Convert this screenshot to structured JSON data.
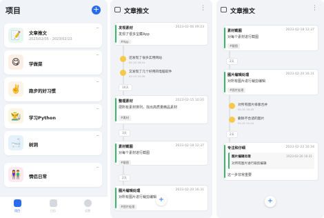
{
  "sidebar": {
    "title": "项目",
    "items": [
      {
        "title": "文章推文",
        "sub": "2023/02/05 - 2023/02/23",
        "emoji": "📝",
        "bg": "#e9f6ef"
      },
      {
        "title": "学做菜",
        "sub": "",
        "emoji": "😋",
        "bg": "#fdeee6"
      },
      {
        "title": "跑步的好习惯",
        "sub": "",
        "emoji": "✌️",
        "bg": "#fdf3e6"
      },
      {
        "title": "学习Python",
        "sub": "",
        "emoji": "👨‍🌾",
        "bg": "#fbf6e3"
      },
      {
        "title": "树洞",
        "sub": "",
        "emoji": "🛁",
        "bg": "#e6f2fb"
      },
      {
        "title": "情侣日常",
        "sub": "",
        "emoji": "👫",
        "bg": "#fdeaf0"
      }
    ],
    "tabs": [
      "项目",
      "日历",
      "设置"
    ],
    "accent": "#2a6cf0"
  },
  "middle": {
    "title": "文章推文",
    "notes": [
      {
        "title": "发现素材",
        "date": "2023-02-06 09:23",
        "body": "发现了很多宝藏App",
        "tag": "#App"
      },
      {
        "title": "整理素材",
        "date": "2023-02-15 10:20",
        "body": "把所有素材排列，找出高质量精品素材",
        "tag": "#素材"
      },
      {
        "title": "素材截图",
        "date": "2023-02-18 12:37",
        "body": "对每个素材进行截图",
        "tag": "#截图"
      },
      {
        "title": "图片编辑处理",
        "date": "2023-02-20 16:31",
        "body": "对所有图片进行裁剪编辑",
        "tag": "#图片处理"
      }
    ],
    "comments": [
      {
        "text": "还发现了很多实用网站",
        "time": "02-10 16:24"
      },
      {
        "text": "又发现了几个好用的电脑软件",
        "time": "02-13 15:28"
      }
    ],
    "gaps": [
      "10天",
      "3天",
      "2天"
    ]
  },
  "right": {
    "title": "文章推文",
    "notes": [
      {
        "title": "素材截图",
        "date": "2023-02-18 12:37",
        "body": "对每个素材进行截图",
        "tag": "#截图"
      },
      {
        "title": "图片编辑处理",
        "date": "2023-02-20 16:31",
        "body": "对所有图片进行裁剪编辑",
        "tag": "#图片处理"
      },
      {
        "title": "专注和仔细",
        "date": "2023-02-22 16:34",
        "body": "这一步非常重要"
      }
    ],
    "gaps": [
      "2天",
      "2天"
    ],
    "comments": [
      {
        "text": "对所有图片排版合并",
        "time": "02-21 10:45"
      },
      {
        "text": "删除不合适的图片",
        "time": "02-21 21:24"
      }
    ],
    "quote": {
      "title": "图片编辑处理",
      "date": "2023-02-20 16:31",
      "body": "对所有图片进行裁剪编辑"
    }
  }
}
